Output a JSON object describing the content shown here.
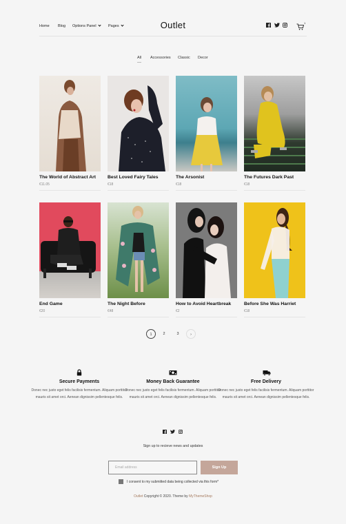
{
  "header": {
    "nav": [
      {
        "label": "Home"
      },
      {
        "label": "Blog"
      },
      {
        "label": "Options Panel"
      },
      {
        "label": "Pages"
      }
    ],
    "logo": "Outlet",
    "cart_count": "1"
  },
  "filters": [
    "All",
    "Accessories",
    "Classic",
    "Decor"
  ],
  "products": [
    {
      "title": "The World of Abstract Art",
      "price": "€11.05"
    },
    {
      "title": "Best Loved Fairy Tales",
      "price": "€18"
    },
    {
      "title": "The Arsonist",
      "price": "€18"
    },
    {
      "title": "The Futures Dark Past",
      "price": "€18"
    },
    {
      "title": "End Game",
      "price": "€20"
    },
    {
      "title": "The Night Before",
      "price": "€48"
    },
    {
      "title": "How to Avoid Heartbreak",
      "price": "€2"
    },
    {
      "title": "Before She Was Harriet",
      "price": "€18"
    }
  ],
  "pagination": {
    "pages": [
      "1",
      "2",
      "3"
    ],
    "current": "1",
    "next": "›"
  },
  "features": [
    {
      "icon": "lock-icon",
      "title": "Secure Payments",
      "text": "Donec nec justo eget felis facilisis fermentum. Aliquam porttitor mauris sit amet orci. Aenean dignissim pellentesque felis."
    },
    {
      "icon": "money-icon",
      "title": "Money Back Guarantee",
      "text": "Donec nec justo eget felis facilisis fermentum. Aliquam porttitor mauris sit amet orci. Aenean dignissim pellentesque felis."
    },
    {
      "icon": "truck-icon",
      "title": "Free Delivery",
      "text": "Donec nec justo eget felis facilisis fermentum. Aliquam porttitor mauris sit amet orci. Aenean dignissim pellentesque felis."
    }
  ],
  "newsletter": {
    "heading": "Sign up to recieve news and updates",
    "email_placeholder": "Email address",
    "button": "Sign Up",
    "consent": "I consent to my submitted data being collected via this form*"
  },
  "footer": {
    "brand": "Outlet",
    "mid": " Copyright © 2020. Theme by ",
    "author": "MyThemeShop"
  },
  "colors": {
    "accent": "#c4a69a",
    "brand_link": "#a57a5e",
    "background": "#f5f5f5"
  }
}
